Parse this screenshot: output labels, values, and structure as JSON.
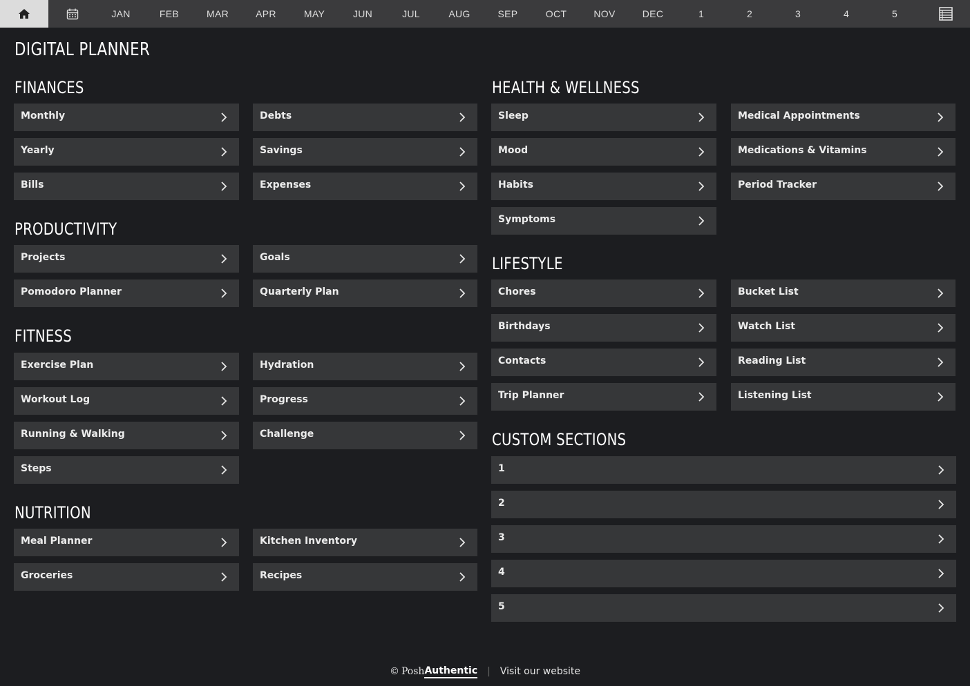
{
  "topnav": {
    "months": [
      "JAN",
      "FEB",
      "MAR",
      "APR",
      "MAY",
      "JUN",
      "JUL",
      "AUG",
      "SEP",
      "OCT",
      "NOV",
      "DEC"
    ],
    "numbers": [
      "1",
      "2",
      "3",
      "4",
      "5"
    ],
    "icons": {
      "home": "home-icon",
      "calendar": "calendar-icon",
      "list": "list-icon"
    }
  },
  "page_title": "DIGITAL PLANNER",
  "sections": {
    "finances": {
      "title": "FINANCES",
      "items": [
        "Monthly",
        "Debts",
        "Yearly",
        "Savings",
        "Bills",
        "Expenses"
      ]
    },
    "productivity": {
      "title": "PRODUCTIVITY",
      "items": [
        "Projects",
        "Goals",
        "Pomodoro Planner",
        "Quarterly Plan"
      ]
    },
    "fitness": {
      "title": "FITNESS",
      "items": [
        "Exercise Plan",
        "Hydration",
        "Workout Log",
        "Progress",
        "Running & Walking",
        "Challenge",
        "Steps"
      ]
    },
    "nutrition": {
      "title": "NUTRITION",
      "items": [
        "Meal Planner",
        "Kitchen Inventory",
        "Groceries",
        "Recipes"
      ]
    },
    "health": {
      "title": "HEALTH & WELLNESS",
      "items": [
        "Sleep",
        "Medical Appointments",
        "Mood",
        "Medications & Vitamins",
        "Habits",
        "Period Tracker",
        "Symptoms"
      ]
    },
    "lifestyle": {
      "title": "LIFESTYLE",
      "items": [
        "Chores",
        "Bucket List",
        "Birthdays",
        "Watch List",
        "Contacts",
        "Reading List",
        "Trip Planner",
        "Listening List"
      ]
    },
    "custom": {
      "title": "CUSTOM SECTIONS",
      "items": [
        "1",
        "2",
        "3",
        "4",
        "5"
      ]
    }
  },
  "footer": {
    "copyright_symbol": "©",
    "brand_prefix": "Posh",
    "brand_bold": "Authentic",
    "separator": "|",
    "link": "Visit our website"
  },
  "colors": {
    "background": "#1c1d20",
    "topnav": "#3b3b3d",
    "home_tab": "#dcdcdc",
    "button": "#363739",
    "text": "#ffffff"
  }
}
